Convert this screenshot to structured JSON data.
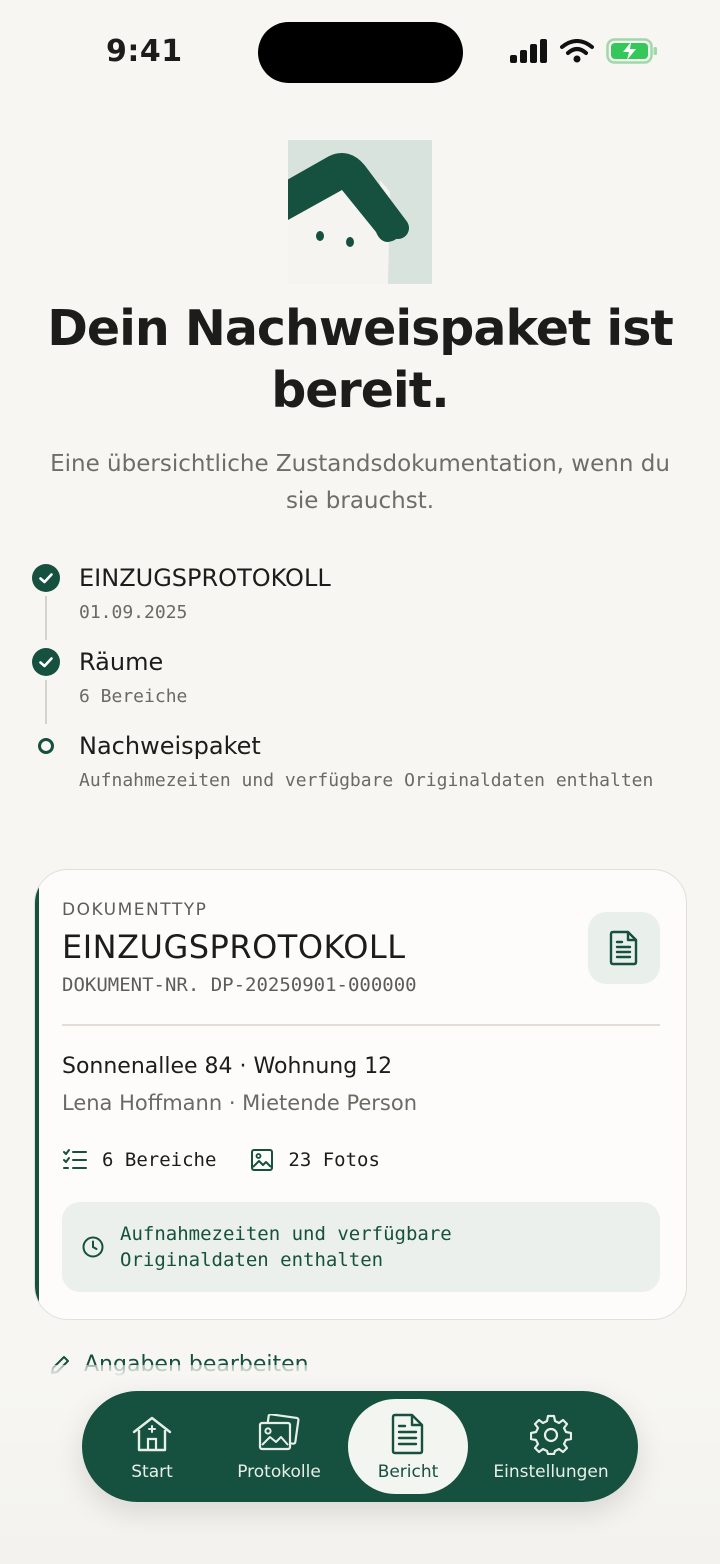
{
  "status_bar": {
    "time": "9:41"
  },
  "hero": {
    "headline": "Dein Nachweispaket ist bereit.",
    "subline": "Eine übersichtliche Zustandsdokumentation, wenn du sie brauchst."
  },
  "timeline": [
    {
      "title": "EINZUGSPROTOKOLL",
      "sub": "01.09.2025",
      "state": "done"
    },
    {
      "title": "Räume",
      "sub": "6 Bereiche",
      "state": "done"
    },
    {
      "title": "Nachweispaket",
      "sub": "Aufnahmezeiten und verfügbare Originaldaten enthalten",
      "state": "current"
    }
  ],
  "card": {
    "kicker": "DOKUMENTTYP",
    "title": "EINZUGSPROTOKOLL",
    "doc_nr": "DOKUMENT-NR. DP-20250901-000000",
    "address": "Sonnenallee 84 · Wohnung 12",
    "person": "Lena Hoffmann · Mietende Person",
    "areas": "6 Bereiche",
    "photos": "23 Fotos",
    "note": "Aufnahmezeiten und verfügbare Originaldaten enthalten"
  },
  "edit_link": "Angaben bearbeiten",
  "tabs": [
    {
      "label": "Start",
      "icon": "house-icon"
    },
    {
      "label": "Protokolle",
      "icon": "photos-icon"
    },
    {
      "label": "Bericht",
      "icon": "document-icon",
      "active": true
    },
    {
      "label": "Einstellungen",
      "icon": "gear-icon"
    }
  ],
  "colors": {
    "brand": "#16503f",
    "background": "#f7f6f2",
    "battery": "#34c759"
  }
}
